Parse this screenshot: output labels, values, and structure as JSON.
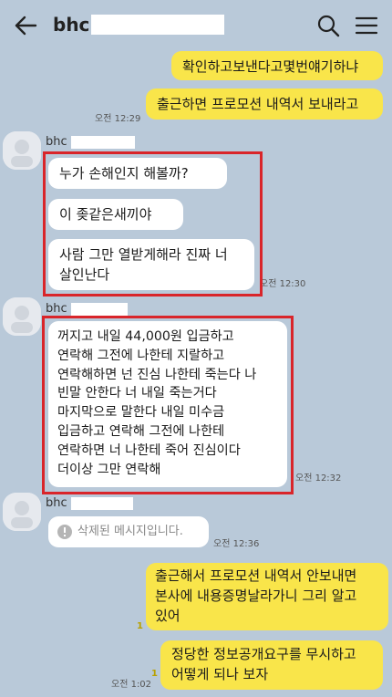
{
  "header": {
    "title": "bhc"
  },
  "messages": {
    "m1": "확인하고보낸다고몇번얘기하냐",
    "m2": "출근하면 프로모션 내역서 보내라고",
    "t1": "오전 12:29",
    "g1_sender": "bhc",
    "g1_b1": "누가 손해인지 해볼까?",
    "g1_b2": "이 좆같은새끼야",
    "g1_b3_l1": "사람 그만 열받게해라 진짜 너",
    "g1_b3_l2": "살인난다",
    "t2": "오전 12:30",
    "g2_sender": "bhc",
    "g2_lines": [
      "꺼지고 내일 44,000원 입금하고",
      "연락해 그전에 나한테 지랄하고",
      "연락해하면 넌 진심 나한테 죽는다 나",
      "빈말 안한다 너 내일 죽는거다",
      "마지막으로 말한다 내일 미수금",
      "입금하고 연락해 그전에 나한테",
      "연락하면 너 나한테 죽어 진심이다",
      "더이상 그만 연락해"
    ],
    "t3": "오전 12:32",
    "g3_sender": "bhc",
    "g3_deleted": "삭제된 메시지입니다.",
    "t4": "오전 12:36",
    "m3_lines": [
      "출근해서 프로모션 내역서 안보내면",
      "본사에 내용증명날라가니 그리 알고",
      "있어"
    ],
    "read1": "1",
    "m4_lines": [
      "정당한 정보공개요구를 무시하고",
      "어떻게 되나 보자"
    ],
    "read2": "1",
    "t5": "오전 1:02"
  },
  "icons": {
    "back": "back-arrow-icon",
    "search": "search-icon",
    "menu": "hamburger-menu-icon",
    "deleted": "info-icon"
  },
  "colors": {
    "background": "#b9c9d9",
    "my_bubble": "#f9e54a",
    "their_bubble": "#ffffff",
    "highlight_box": "#d9252a"
  }
}
